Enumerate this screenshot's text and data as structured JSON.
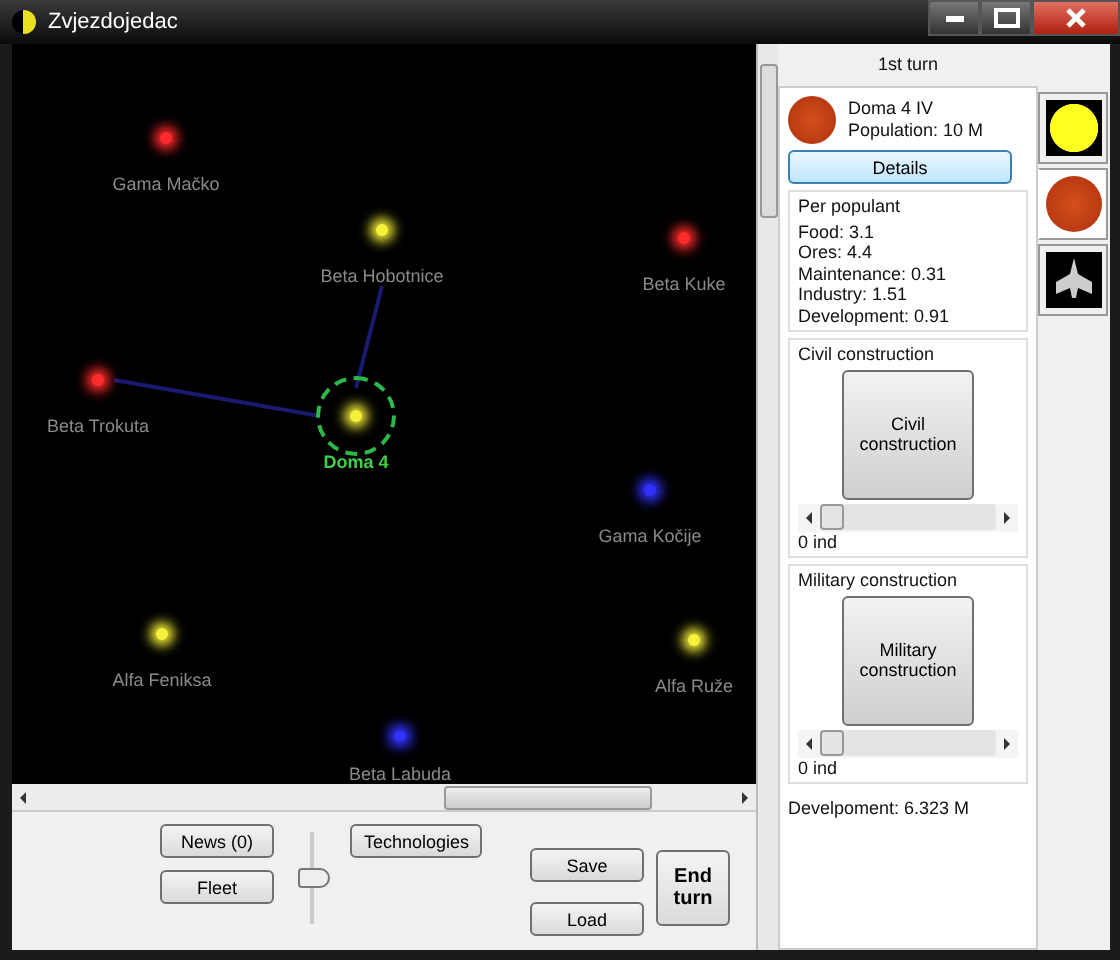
{
  "window": {
    "title": "Zvjezdojedac"
  },
  "map": {
    "stars": [
      {
        "name": "Gama Mačko",
        "color": "#ff2a2a",
        "selected": false
      },
      {
        "name": "Beta Hobotnice",
        "color": "#f5f03a",
        "selected": false
      },
      {
        "name": "Beta Kuke",
        "color": "#ff2a2a",
        "selected": false
      },
      {
        "name": "Beta Trokuta",
        "color": "#ff2a2a",
        "selected": false
      },
      {
        "name": "Doma 4",
        "color": "#f5f03a",
        "selected": true
      },
      {
        "name": "Gama Kočije",
        "color": "#3030ff",
        "selected": false
      },
      {
        "name": "Alfa Feniksa",
        "color": "#f5f03a",
        "selected": false
      },
      {
        "name": "Alfa Ruže",
        "color": "#f5f03a",
        "selected": false
      },
      {
        "name": "Beta Labuda",
        "color": "#3030ff",
        "selected": false
      }
    ]
  },
  "bottom": {
    "buttons": [
      "News (0)",
      "Fleet",
      "Technologies",
      "Save",
      "Load",
      "End turn"
    ],
    "zoom_slider": {
      "level": 0.5
    }
  },
  "side": {
    "turn": "1st turn",
    "planet": {
      "name": "Doma 4 IV",
      "population": "Population: 10 M"
    },
    "details_button": "Details",
    "per_populant": {
      "title": "Per populant",
      "lines": [
        "Food: 3.1",
        "Ores: 4.4",
        "Maintenance: 0.31",
        "Industry: 1.51",
        "Development: 0.91"
      ]
    },
    "constructions": [
      {
        "title": "Civil construction",
        "button": "Civil construction",
        "level": 0,
        "reading": "0 ind"
      },
      {
        "title": "Military construction",
        "button": "Military construction",
        "level": 0,
        "reading": "0 ind"
      }
    ],
    "development": "Develpoment: 6.323 M",
    "tabs": [
      {
        "kind": "star",
        "selected": false
      },
      {
        "kind": "planet",
        "selected": true
      },
      {
        "kind": "ship",
        "selected": false
      }
    ]
  }
}
